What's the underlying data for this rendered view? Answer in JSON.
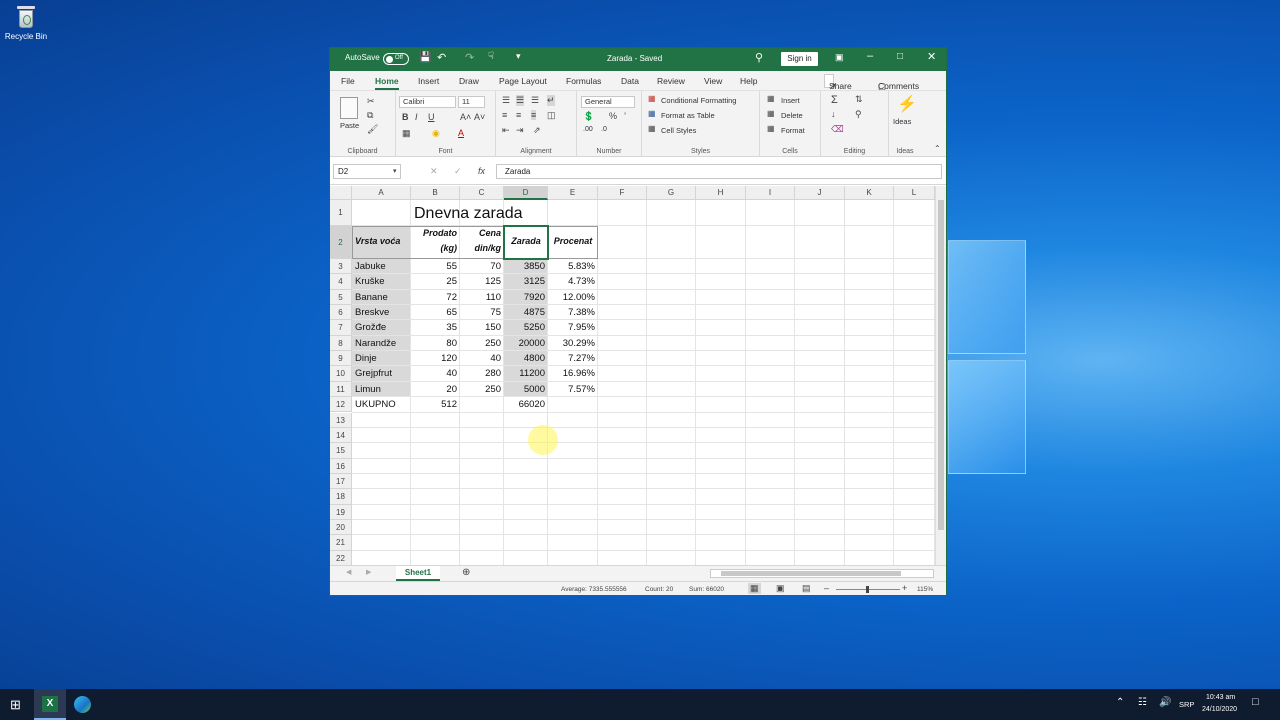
{
  "desktop": {
    "recycle_bin_label": "Recycle Bin"
  },
  "window": {
    "autosave_label": "AutoSave",
    "autosave_state": "Off",
    "title": "Zarada - Saved",
    "sign_in": "Sign in"
  },
  "menu": {
    "tabs": [
      "File",
      "Home",
      "Insert",
      "Draw",
      "Page Layout",
      "Formulas",
      "Data",
      "Review",
      "View",
      "Help"
    ],
    "active": "Home",
    "share": "Share",
    "comments": "Comments"
  },
  "ribbon": {
    "clipboard": {
      "paste": "Paste",
      "label": "Clipboard"
    },
    "font": {
      "name": "Calibri",
      "size": "11",
      "label": "Font"
    },
    "alignment": {
      "label": "Alignment"
    },
    "number": {
      "format": "General",
      "label": "Number"
    },
    "styles": {
      "conditional": "Conditional Formatting",
      "format_table": "Format as Table",
      "cell_styles": "Cell Styles",
      "label": "Styles"
    },
    "cells": {
      "insert": "Insert",
      "delete": "Delete",
      "format": "Format",
      "label": "Cells"
    },
    "editing": {
      "label": "Editing"
    },
    "ideas": {
      "button": "Ideas",
      "label": "Ideas"
    }
  },
  "formula_bar": {
    "name_box": "D2",
    "fx": "fx",
    "content": "Zarada"
  },
  "sheet": {
    "columns": [
      "A",
      "B",
      "C",
      "D",
      "E",
      "F",
      "G",
      "H",
      "I",
      "J",
      "K",
      "L"
    ],
    "selected_column": "D",
    "rows": [
      "1",
      "2",
      "3",
      "4",
      "5",
      "6",
      "7",
      "8",
      "9",
      "10",
      "11",
      "12",
      "13",
      "14",
      "15",
      "16",
      "17",
      "18",
      "19",
      "20",
      "21",
      "22"
    ],
    "title": "Dnevna zarada",
    "headers": {
      "a": "Vrsta voća",
      "b1": "Prodato",
      "b2": "(kg)",
      "c1": "Cena",
      "c2": "din/kg",
      "d": "Zarada",
      "e": "Procenat"
    },
    "data": [
      [
        "Jabuke",
        "55",
        "70",
        "3850",
        "5.83%"
      ],
      [
        "Kruške",
        "25",
        "125",
        "3125",
        "4.73%"
      ],
      [
        "Banane",
        "72",
        "110",
        "7920",
        "12.00%"
      ],
      [
        "Breskve",
        "65",
        "75",
        "4875",
        "7.38%"
      ],
      [
        "Grožđe",
        "35",
        "150",
        "5250",
        "7.95%"
      ],
      [
        "Narandže",
        "80",
        "250",
        "20000",
        "30.29%"
      ],
      [
        "Dinje",
        "120",
        "40",
        "4800",
        "7.27%"
      ],
      [
        "Grejpfrut",
        "40",
        "280",
        "11200",
        "16.96%"
      ],
      [
        "Limun",
        "20",
        "250",
        "5000",
        "7.57%"
      ]
    ],
    "total": {
      "label": "UKUPNO",
      "b": "512",
      "d": "66020"
    },
    "sheet_tab": "Sheet1"
  },
  "status": {
    "average": "Average: 7335.555556",
    "count": "Count: 20",
    "sum": "Sum: 66020",
    "zoom": "115%"
  },
  "taskbar": {
    "lang": "SRP",
    "time": "10:43 am",
    "date": "24/10/2020"
  }
}
